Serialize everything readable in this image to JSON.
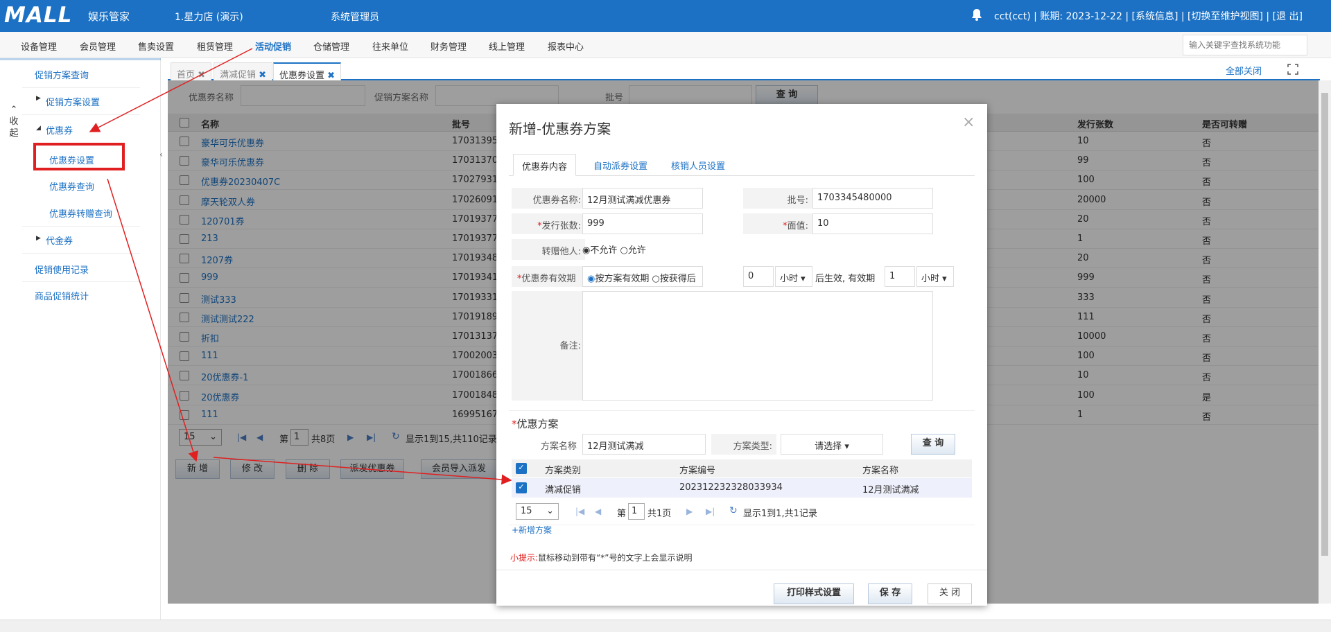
{
  "header": {
    "logo": "MALL",
    "logo_sub": "娱乐管家",
    "store": "1.星力店 (演示)",
    "role": "系统管理员",
    "user": "cct(cct)",
    "date_line": "| 账期: 2023-12-22",
    "sys_info": "| [系统信息]",
    "switch_view": "| [切换至维护视图]",
    "logout": "| [退 出]"
  },
  "menu": [
    "设备管理",
    "会员管理",
    "售卖设置",
    "租赁管理",
    "活动促销",
    "仓储管理",
    "往来单位",
    "财务管理",
    "线上管理",
    "报表中心"
  ],
  "menu_active": "活动促销",
  "search_placeholder": "输入关键字查找系统功能",
  "sidebar": {
    "collapse": [
      "收",
      "起"
    ],
    "items": [
      "促销方案查询",
      "促销方案设置",
      "优惠券",
      "优惠券设置",
      "优惠券查询",
      "优惠券转赠查询",
      "代金券",
      "促销使用记录",
      "商品促销统计"
    ]
  },
  "tabs": [
    "首页",
    "满减促销",
    "优惠券设置"
  ],
  "close_all": "全部关闭",
  "filter": {
    "coupon_name": "优惠券名称",
    "plan_name": "促销方案名称",
    "batch": "批号",
    "query": "查 询"
  },
  "table": {
    "headers": [
      "名称",
      "批号",
      "发行张数",
      "是否可转赠"
    ],
    "rows": [
      {
        "name": "豪华可乐优惠券",
        "batch": "17031395",
        "count": "10",
        "transfer": "否"
      },
      {
        "name": "豪华可乐优惠券",
        "batch": "17031370",
        "count": "99",
        "transfer": "否"
      },
      {
        "name": "优惠券20230407C",
        "batch": "17027931",
        "count": "100",
        "transfer": "否"
      },
      {
        "name": "摩天轮双人券",
        "batch": "17026091",
        "count": "20000",
        "transfer": "否"
      },
      {
        "name": "120701券",
        "batch": "17019377",
        "count": "20",
        "transfer": "否"
      },
      {
        "name": "213",
        "batch": "17019377",
        "count": "1",
        "transfer": "否"
      },
      {
        "name": "1207券",
        "batch": "17019348",
        "count": "20",
        "transfer": "否"
      },
      {
        "name": "999",
        "batch": "17019341",
        "count": "999",
        "transfer": "否"
      },
      {
        "name": "测试333",
        "batch": "17019331",
        "count": "333",
        "transfer": "否"
      },
      {
        "name": "测试测试222",
        "batch": "17019189",
        "count": "111",
        "transfer": "否"
      },
      {
        "name": "折扣",
        "batch": "17013137",
        "count": "10000",
        "transfer": "否"
      },
      {
        "name": "111",
        "batch": "17002003",
        "count": "100",
        "transfer": "否"
      },
      {
        "name": "20优惠券-1",
        "batch": "17001866",
        "count": "10",
        "transfer": "否"
      },
      {
        "name": "20优惠券",
        "batch": "17001848",
        "count": "100",
        "transfer": "是"
      },
      {
        "name": "111",
        "batch": "16995167",
        "count": "1",
        "transfer": "否"
      }
    ]
  },
  "pager": {
    "size": "15",
    "page_prefix": "第",
    "page": "1",
    "total_pages": "共8页",
    "summary": "显示1到15,共110记录"
  },
  "actions": [
    "新 增",
    "修 改",
    "删 除",
    "派发优惠券",
    "会员导入派发"
  ],
  "modal": {
    "title": "新增-优惠券方案",
    "tabs": [
      "优惠券内容",
      "自动派券设置",
      "核销人员设置"
    ],
    "coupon_name_label": "优惠券名称:",
    "coupon_name": "12月测试满减优惠券",
    "batch_label": "批号:",
    "batch": "1703345480000",
    "count_label": "发行张数:",
    "count": "999",
    "face_label": "面值:",
    "face": "10",
    "transfer_label": "转赠他人:",
    "transfer_no": "不允许",
    "transfer_yes": "允许",
    "validity_label": "优惠券有效期",
    "validity_opt1": "按方案有效期",
    "validity_opt2": "按获得后",
    "delay_value": "0",
    "delay_unit": "小时",
    "after_text": "后生效, 有效期",
    "valid_value": "1",
    "valid_unit": "小时",
    "note_label": "备注:",
    "plan_section": "优惠方案",
    "plan_name_label": "方案名称",
    "plan_name": "12月测试满减",
    "plan_type_label": "方案类型:",
    "plan_type": "请选择",
    "query": "查 询",
    "plan_headers": [
      "方案类别",
      "方案编号",
      "方案名称"
    ],
    "plan_rows": [
      {
        "type": "满减促销",
        "code": "202312232328033934",
        "name": "12月测试满减"
      }
    ],
    "plan_pager": {
      "size": "15",
      "page_prefix": "第",
      "page": "1",
      "total": "共1页",
      "summary": "显示1到1,共1记录"
    },
    "add_plan": "+新增方案",
    "tip_label": "小提示:",
    "tip_text": "鼠标移动到带有“*”号的文字上会显示说明",
    "print_btn": "打印样式设置",
    "save_btn": "保 存",
    "close_btn": "关 闭"
  },
  "colors": {
    "brand": "#1c71c4",
    "annotation": "#e02020"
  }
}
